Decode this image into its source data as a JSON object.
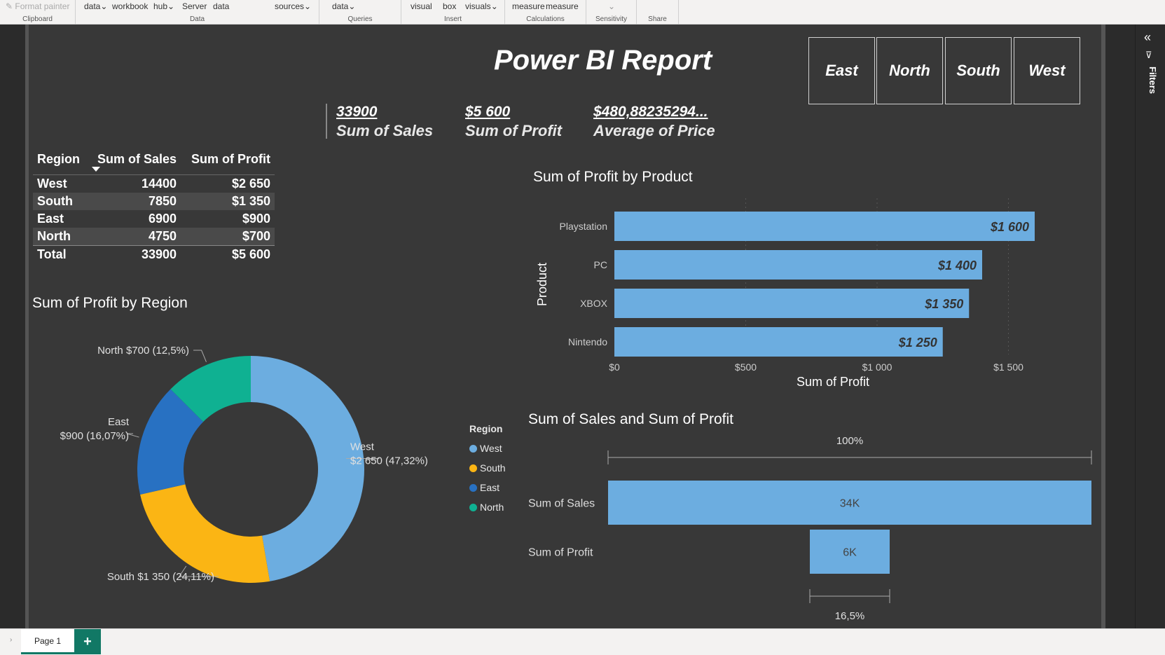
{
  "ribbon": {
    "groups": [
      {
        "label": "Clipboard",
        "items": [
          "Format painter"
        ]
      },
      {
        "label": "Data",
        "items": [
          "data",
          "workbook",
          "hub",
          "Server",
          "data",
          "sources"
        ]
      },
      {
        "label": "Queries",
        "items": [
          "data"
        ]
      },
      {
        "label": "Insert",
        "items": [
          "visual",
          "box",
          "visuals"
        ]
      },
      {
        "label": "Calculations",
        "items": [
          "measure",
          "measure"
        ]
      },
      {
        "label": "Sensitivity",
        "items": [
          ""
        ]
      },
      {
        "label": "Share",
        "items": [
          ""
        ]
      }
    ]
  },
  "report": {
    "title": "Power BI Report",
    "slicers": [
      "East",
      "North",
      "South",
      "West"
    ],
    "cards": [
      {
        "value": "33900",
        "label": "Sum of Sales"
      },
      {
        "value": "$5 600",
        "label": "Sum of Profit"
      },
      {
        "value": "$480,88235294...",
        "label": "Average of Price"
      }
    ],
    "table": {
      "headers": [
        "Region",
        "Sum of Sales",
        "Sum of Profit"
      ],
      "rows": [
        [
          "West",
          "14400",
          "$2 650"
        ],
        [
          "South",
          "7850",
          "$1 350"
        ],
        [
          "East",
          "6900",
          "$900"
        ],
        [
          "North",
          "4750",
          "$700"
        ]
      ],
      "total": [
        "Total",
        "33900",
        "$5 600"
      ]
    }
  },
  "filters": {
    "label": "Filters"
  },
  "pages": {
    "tab": "Page 1",
    "add": "+"
  },
  "colors": {
    "west": "#6cade0",
    "south": "#fbb514",
    "east": "#2871c2",
    "north": "#0fb192",
    "bar": "#6cade0",
    "canvas": "#383838"
  },
  "chart_data": [
    {
      "type": "pie",
      "title": "Sum of Profit by Region",
      "legend_title": "Region",
      "legend_position": "right",
      "categories": [
        "West",
        "South",
        "East",
        "North"
      ],
      "values": [
        2650,
        1350,
        900,
        700
      ],
      "labels": [
        {
          "line1": "West",
          "line2": "$2 650 (47,32%)"
        },
        {
          "line1": "South $1 350 (24,11%)",
          "line2": ""
        },
        {
          "line1": "East",
          "line2": "$900 (16,07%)"
        },
        {
          "line1": "North $700 (12,5%)",
          "line2": ""
        }
      ]
    },
    {
      "type": "bar",
      "title": "Sum of Profit by Product",
      "xlabel": "Sum of Profit",
      "ylabel": "Product",
      "categories": [
        "Playstation",
        "PC",
        "XBOX",
        "Nintendo"
      ],
      "values": [
        1600,
        1400,
        1350,
        1250
      ],
      "data_labels": [
        "$1 600",
        "$1 400",
        "$1 350",
        "$1 250"
      ],
      "xlim": [
        0,
        1600
      ],
      "xticks": [
        0,
        500,
        1000,
        1500
      ],
      "xtick_labels": [
        "$0",
        "$500",
        "$1 000",
        "$1 500"
      ],
      "grid": true
    },
    {
      "type": "bar",
      "title": "Sum of Sales and Sum of Profit",
      "categories": [
        "Sum of Sales",
        "Sum of Profit"
      ],
      "values": [
        33900,
        5600
      ],
      "data_labels": [
        "34K",
        "6K"
      ],
      "top_label": "100%",
      "bottom_label": "16,5%"
    }
  ]
}
